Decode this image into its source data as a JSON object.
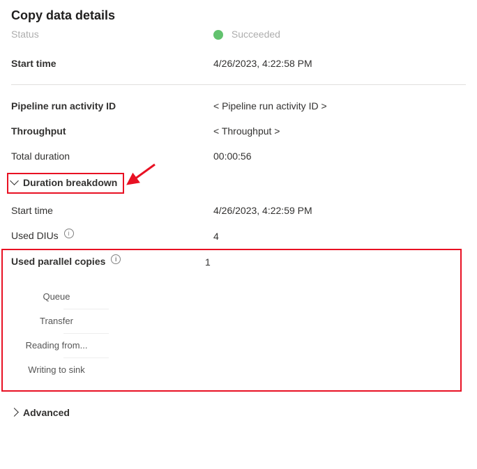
{
  "title": "Copy data details",
  "status_cut": {
    "label": "Status",
    "value": "Succeeded"
  },
  "rows_top": {
    "start_time": {
      "label": "Start time",
      "value": "4/26/2023, 4:22:58 PM",
      "bold": true
    }
  },
  "rows_mid": {
    "pipeline_id": {
      "label": "Pipeline run activity ID",
      "value": "< Pipeline run activity ID >",
      "bold": true
    },
    "throughput": {
      "label": "Throughput",
      "value": "< Throughput >",
      "bold": true
    },
    "total_duration": {
      "label": "Total duration",
      "value": "00:00:56"
    }
  },
  "breakdown": {
    "header": "Duration breakdown",
    "start_time": {
      "label": "Start time",
      "value": "4/26/2023, 4:22:59 PM"
    },
    "used_dius": {
      "label": "Used DIUs",
      "value": "4"
    },
    "used_parallel": {
      "label": "Used parallel copies",
      "value": "1"
    },
    "sub_items": [
      {
        "label": "Queue"
      },
      {
        "label": "Transfer"
      },
      {
        "label": "Reading from..."
      },
      {
        "label": "Writing to sink"
      }
    ]
  },
  "advanced_label": "Advanced"
}
